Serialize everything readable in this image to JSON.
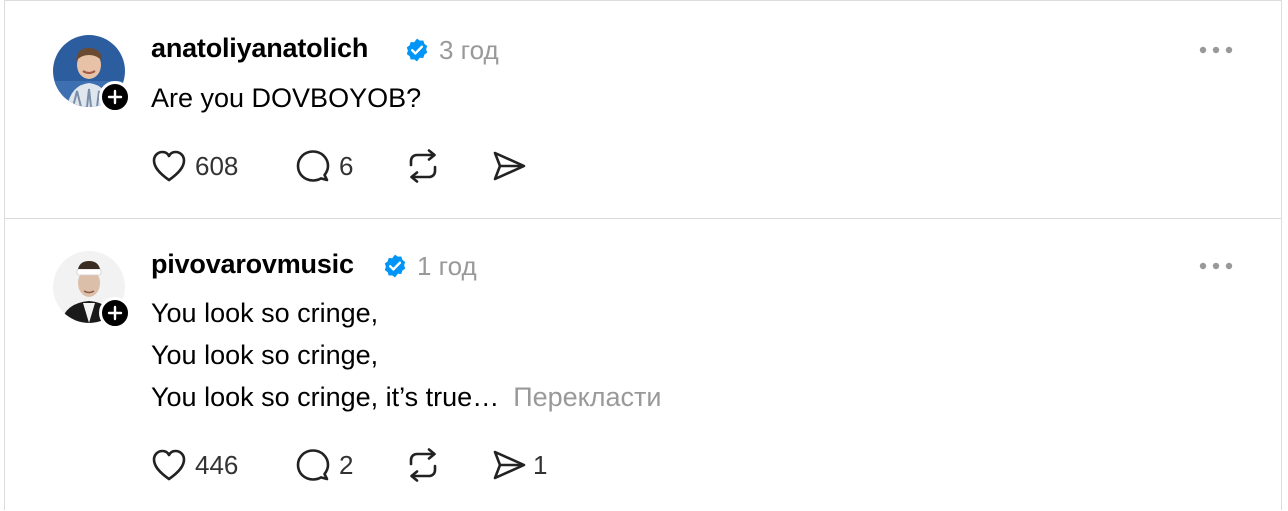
{
  "posts": [
    {
      "username": "anatoliyanatolich",
      "time": "3 год",
      "lines": [
        "Are you DOVBOYOB?"
      ],
      "likes": "608",
      "replies": "6",
      "reposts": "",
      "shares": ""
    },
    {
      "username": "pivovarovmusic",
      "time": "1 год",
      "lines": [
        "You look so cringe,",
        "You look so cringe,",
        "You look so cringe, it’s true…"
      ],
      "translate": "Перекласти",
      "likes": "446",
      "replies": "2",
      "reposts": "",
      "shares": "1"
    }
  ],
  "icons": {
    "verified": "verified-badge-icon",
    "more": "more-options-icon",
    "like": "heart-icon",
    "reply": "comment-bubble-icon",
    "repost": "repost-icon",
    "share": "send-icon",
    "follow": "plus-icon"
  },
  "colors": {
    "verified": "#0095f6",
    "muted": "#999999"
  }
}
